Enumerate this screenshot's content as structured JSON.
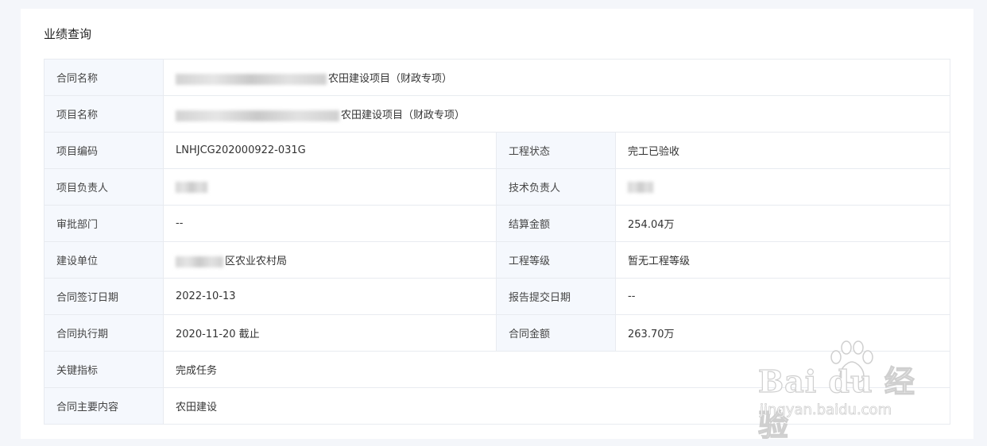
{
  "page_title": "业绩查询",
  "rows": {
    "contract_name": {
      "label": "合同名称",
      "value": "农田建设项目（财政专项）"
    },
    "project_name": {
      "label": "项目名称",
      "value": "农田建设项目（财政专项）"
    },
    "project_code": {
      "label": "项目编码",
      "value": "LNHJCG202000922-031G"
    },
    "project_status": {
      "label": "工程状态",
      "value": "完工已验收"
    },
    "project_leader": {
      "label": "项目负责人",
      "value": ""
    },
    "tech_leader": {
      "label": "技术负责人",
      "value": ""
    },
    "approval_dept": {
      "label": "审批部门",
      "value": "--"
    },
    "settlement_amount": {
      "label": "结算金额",
      "value": "254.04万"
    },
    "construction_unit": {
      "label": "建设单位",
      "value": "区农业农村局"
    },
    "project_grade": {
      "label": "工程等级",
      "value": "暂无工程等级"
    },
    "contract_sign_date": {
      "label": "合同签订日期",
      "value": "2022-10-13"
    },
    "report_submit_date": {
      "label": "报告提交日期",
      "value": "--"
    },
    "contract_period": {
      "label": "合同执行期",
      "value": "2020-11-20 截止"
    },
    "contract_amount": {
      "label": "合同金额",
      "value": "263.70万"
    },
    "key_indicator": {
      "label": "关键指标",
      "value": "完成任务"
    },
    "contract_content": {
      "label": "合同主要内容",
      "value": "农田建设"
    }
  },
  "watermark": {
    "brand": "Bai du 经验",
    "url": "jingyan.baidu.com",
    "icon": "paw-icon"
  }
}
